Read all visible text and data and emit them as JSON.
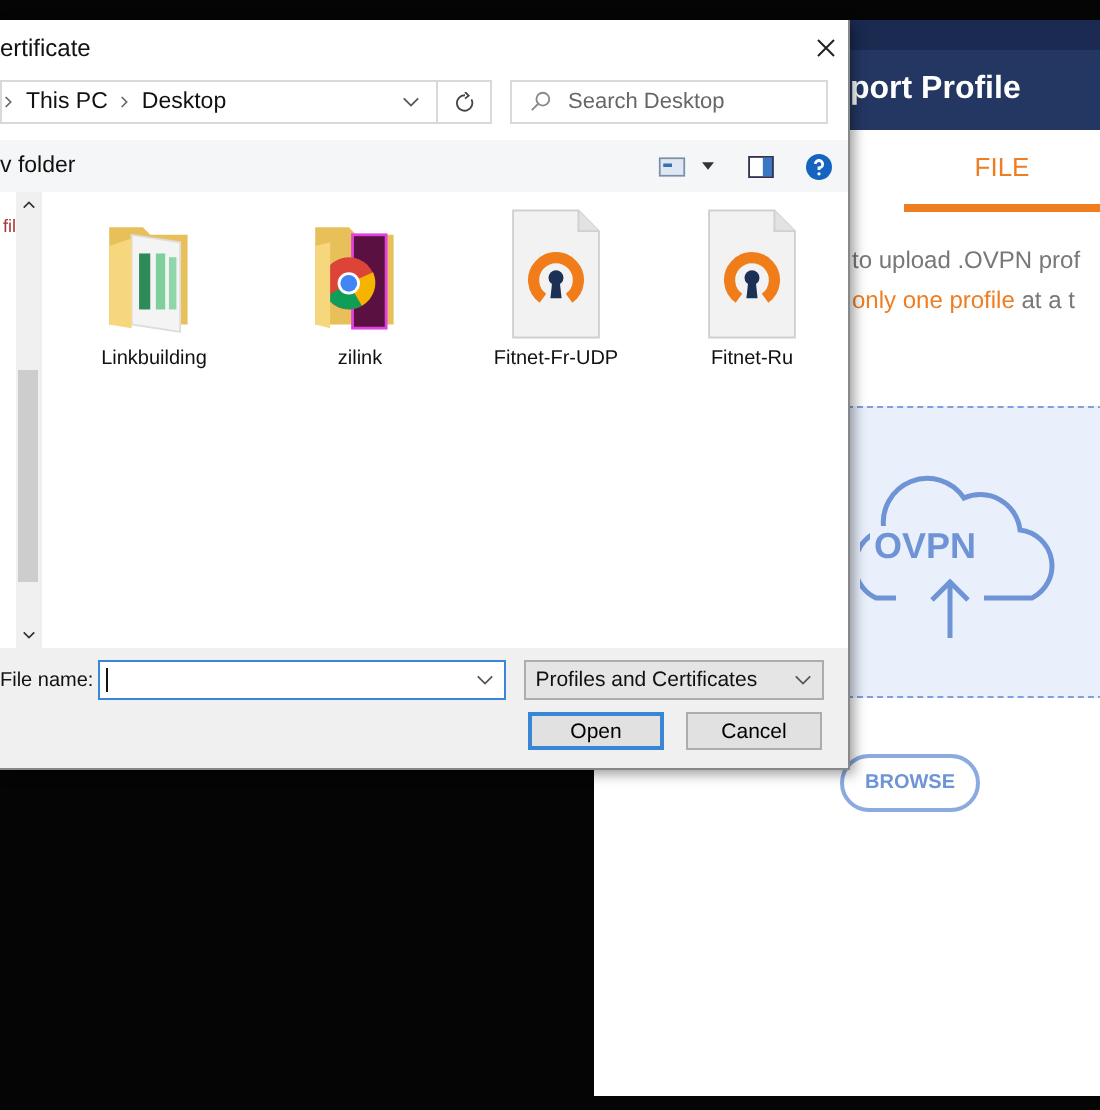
{
  "app_window": {
    "header_title": "port Profile",
    "tabs": [
      {
        "label": "FILE",
        "selected": true
      }
    ],
    "instruction": "to upload .OVPN prof",
    "note_highlight": "only one profile",
    "note_rest": "at a t",
    "drop_label": "OVPN",
    "browse_button": "BROWSE"
  },
  "dialog": {
    "title": "ertificate",
    "breadcrumb": [
      "This PC",
      "Desktop"
    ],
    "search": {
      "placeholder": "Search Desktop"
    },
    "new_folder": "v folder",
    "nav_items": [
      {
        "label": "fil"
      }
    ],
    "files": [
      {
        "name": "Linkbuilding",
        "kind": "folder-sheets"
      },
      {
        "name": "zilink",
        "kind": "folder-chrome"
      },
      {
        "name": "Fitnet-Fr-UDP",
        "kind": "ovpn"
      },
      {
        "name": "Fitnet-Ru",
        "kind": "ovpn"
      }
    ],
    "file_name_label": "File name:",
    "file_type": "Profiles and Certificates",
    "buttons": [
      {
        "label": "Open",
        "default": true
      },
      {
        "label": "Cancel",
        "default": false
      }
    ]
  }
}
